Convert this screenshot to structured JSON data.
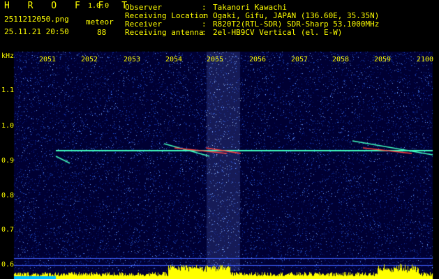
{
  "header": {
    "app_title": "H R O F F T",
    "version": "1.0.0",
    "filename": "2511212050.png",
    "datetime": "25.11.21 20:50",
    "meteor_label": "meteor",
    "meteor_count": "88",
    "info": [
      {
        "key": "Observer",
        "value": "Takanori Kawachi"
      },
      {
        "key": "Receiving Location",
        "value": "Ogaki, Gifu, JAPAN (136.60E, 35.35N)"
      },
      {
        "key": "Receiver",
        "value": "R820T2(RTL-SDR) SDR-Sharp 53.1000MHz"
      },
      {
        "key": "Receiving antenna",
        "value": "2el-HB9CV Vertical (el. E-W)"
      }
    ],
    "separator": ":"
  },
  "axis": {
    "y_unit": "kHz",
    "x_ticks": [
      "2051",
      "2052",
      "2053",
      "2054",
      "2055",
      "2056",
      "2057",
      "2058",
      "2059",
      "2100"
    ],
    "y_ticks": [
      "1.1",
      "1.0",
      "0.9",
      "0.8",
      "0.7",
      "0.6"
    ]
  },
  "colors": {
    "text": "#ffff00",
    "background": "#000033",
    "signal": "#40ffc0",
    "meteor": "#ff4040"
  }
}
